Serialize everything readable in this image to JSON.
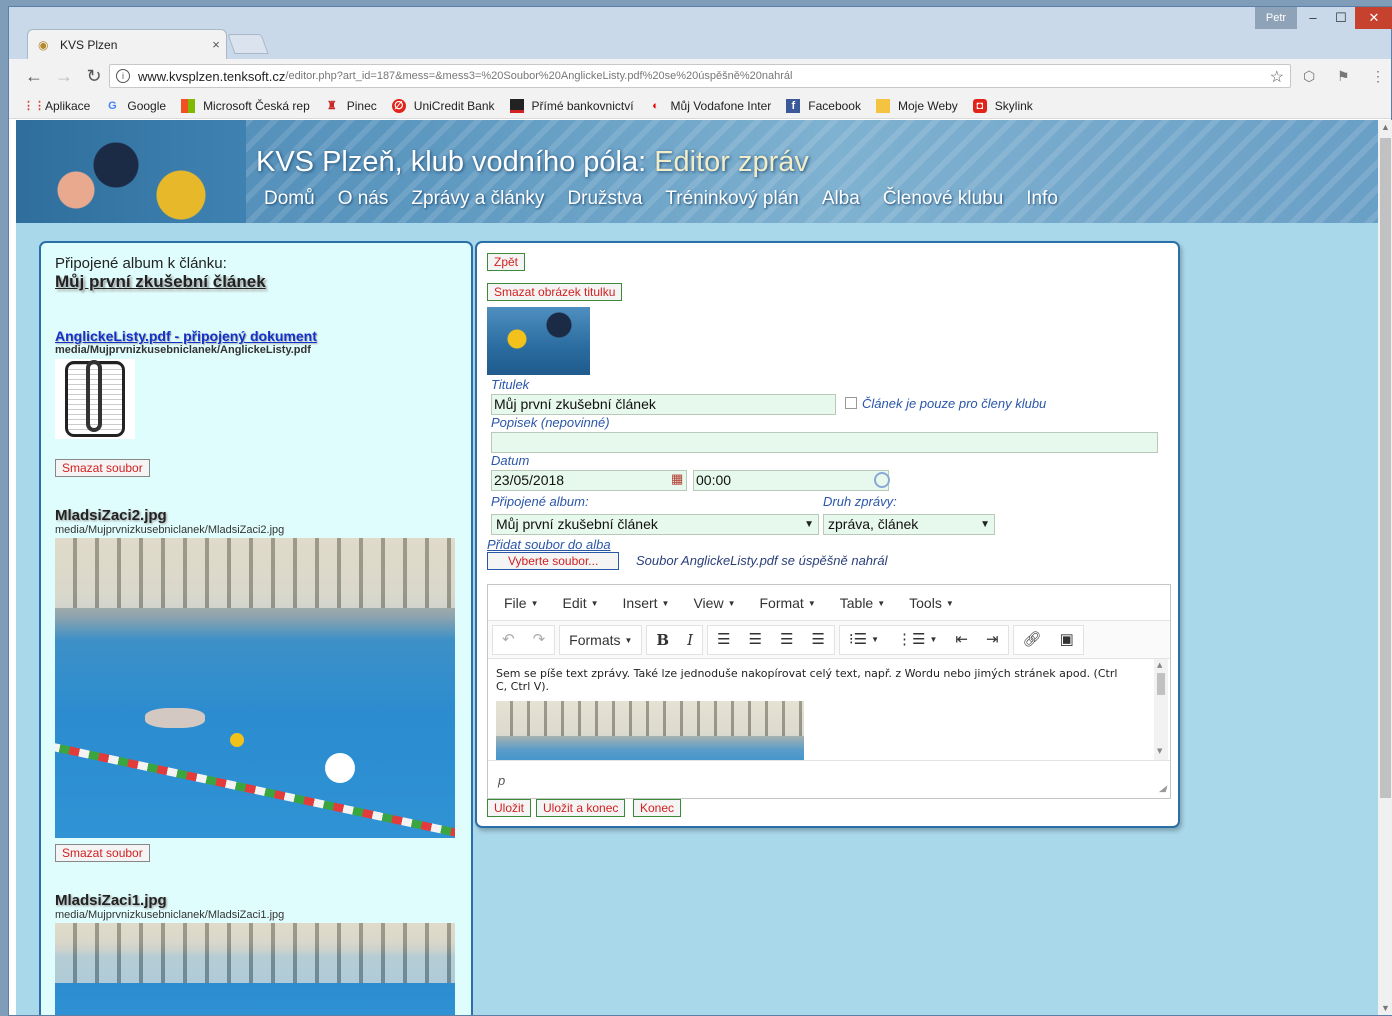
{
  "browser": {
    "tab_title": "KVS Plzen",
    "tab_close": "×",
    "user": "Petr",
    "url_host": "www.kvsplzen.tenksoft.cz",
    "url_path": "/editor.php?art_id=187&mess=&mess3=%20Soubor%20AnglickeListy.pdf%20se%20úspěšně%20nahrál",
    "bookmarks": [
      "Aplikace",
      "Google",
      "Microsoft Česká rep",
      "Pinec",
      "UniCredit Bank",
      "Přímé bankovnictví",
      "Můj Vodafone Inter",
      "Facebook",
      "Moje Weby",
      "Skylink"
    ]
  },
  "site": {
    "title": "KVS Plzeň, klub vodního póla:",
    "subtitle": "Editor zpráv",
    "nav": [
      "Domů",
      "O nás",
      "Zprávy a články",
      "Družstva",
      "Tréninkový plán",
      "Alba",
      "Členové klubu",
      "Info"
    ]
  },
  "left": {
    "caption": "Připojené album k článku:",
    "article": "Můj první zkušební článek",
    "doc_link": "AnglickeListy.pdf - připojený dokument",
    "doc_path": "media/Mujprvnizkusebniclanek/AnglickeListy.pdf",
    "delete_label": "Smazat soubor",
    "images": [
      {
        "name": "MladsiZaci2.jpg",
        "path": "media/Mujprvnizkusebniclanek/MladsiZaci2.jpg"
      },
      {
        "name": "MladsiZaci1.jpg",
        "path": "media/Mujprvnizkusebniclanek/MladsiZaci1.jpg"
      }
    ]
  },
  "editor": {
    "back": "Zpět",
    "delete_title_image": "Smazat obrázek titulku",
    "title_label": "Titulek",
    "title_value": "Můj první zkušební článek",
    "members_only": "Článek je pouze pro členy klubu",
    "desc_label": "Popisek (nepovinné)",
    "desc_value": "",
    "date_label": "Datum",
    "date_value": "23/05/2018",
    "time_value": "00:00",
    "album_label": "Připojené album:",
    "album_value": "Můj první zkušební článek",
    "type_label": "Druh zprávy:",
    "type_value": "zpráva, článek",
    "add_file_label": "Přidat soubor do alba",
    "choose_file": "Vyberte soubor...",
    "upload_message": "Soubor AnglickeListy.pdf se úspěšně nahrál",
    "menu": [
      "File",
      "Edit",
      "Insert",
      "View",
      "Format",
      "Table",
      "Tools"
    ],
    "formats": "Formats",
    "content_text": "Sem se píše text zprávy. Také lze jednoduše nakopírovat celý text, např. z Wordu nebo jimých stránek apod. (Ctrl C, Ctrl V).",
    "statusbar": "p",
    "save": "Uložit",
    "save_close": "Uložit a konec",
    "close": "Konec"
  }
}
